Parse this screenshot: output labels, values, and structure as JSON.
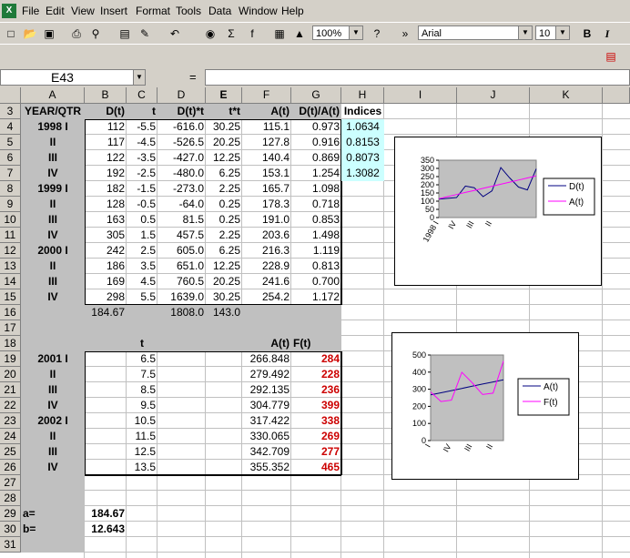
{
  "menu": [
    "File",
    "Edit",
    "View",
    "Insert",
    "Format",
    "Tools",
    "Data",
    "Window",
    "Help"
  ],
  "toolbar": {
    "zoom": "100%",
    "font": "Arial",
    "size": "10",
    "bold": "B",
    "italic": "I"
  },
  "namebox": "E43",
  "formula_eq": "=",
  "columns": [
    "A",
    "B",
    "C",
    "D",
    "E",
    "F",
    "G",
    "H",
    "I",
    "J",
    "K"
  ],
  "rows": [
    {
      "n": "3",
      "a": "YEAR/QTR",
      "b": "D(t)",
      "c": "t",
      "d": "D(t)*t",
      "e": "t*t",
      "f": "A(t)",
      "g": "D(t)/A(t)",
      "h": "Indices"
    },
    {
      "n": "4",
      "a": "1998 I",
      "b": "112",
      "c": "-5.5",
      "d": "-616.0",
      "e": "30.25",
      "f": "115.1",
      "g": "0.973",
      "h": "1.0634"
    },
    {
      "n": "5",
      "a": "II",
      "b": "117",
      "c": "-4.5",
      "d": "-526.5",
      "e": "20.25",
      "f": "127.8",
      "g": "0.916",
      "h": "0.8153"
    },
    {
      "n": "6",
      "a": "III",
      "b": "122",
      "c": "-3.5",
      "d": "-427.0",
      "e": "12.25",
      "f": "140.4",
      "g": "0.869",
      "h": "0.8073"
    },
    {
      "n": "7",
      "a": "IV",
      "b": "192",
      "c": "-2.5",
      "d": "-480.0",
      "e": "6.25",
      "f": "153.1",
      "g": "1.254",
      "h": "1.3082"
    },
    {
      "n": "8",
      "a": "1999 I",
      "b": "182",
      "c": "-1.5",
      "d": "-273.0",
      "e": "2.25",
      "f": "165.7",
      "g": "1.098",
      "h": ""
    },
    {
      "n": "9",
      "a": "II",
      "b": "128",
      "c": "-0.5",
      "d": "-64.0",
      "e": "0.25",
      "f": "178.3",
      "g": "0.718",
      "h": ""
    },
    {
      "n": "10",
      "a": "III",
      "b": "163",
      "c": "0.5",
      "d": "81.5",
      "e": "0.25",
      "f": "191.0",
      "g": "0.853",
      "h": ""
    },
    {
      "n": "11",
      "a": "IV",
      "b": "305",
      "c": "1.5",
      "d": "457.5",
      "e": "2.25",
      "f": "203.6",
      "g": "1.498",
      "h": ""
    },
    {
      "n": "12",
      "a": "2000 I",
      "b": "242",
      "c": "2.5",
      "d": "605.0",
      "e": "6.25",
      "f": "216.3",
      "g": "1.119",
      "h": ""
    },
    {
      "n": "13",
      "a": "II",
      "b": "186",
      "c": "3.5",
      "d": "651.0",
      "e": "12.25",
      "f": "228.9",
      "g": "0.813",
      "h": ""
    },
    {
      "n": "14",
      "a": "III",
      "b": "169",
      "c": "4.5",
      "d": "760.5",
      "e": "20.25",
      "f": "241.6",
      "g": "0.700",
      "h": ""
    },
    {
      "n": "15",
      "a": "IV",
      "b": "298",
      "c": "5.5",
      "d": "1639.0",
      "e": "30.25",
      "f": "254.2",
      "g": "1.172",
      "h": ""
    },
    {
      "n": "16",
      "a": "",
      "b": "184.67",
      "c": "",
      "d": "1808.0",
      "e": "143.0",
      "f": "",
      "g": "",
      "h": ""
    },
    {
      "n": "17",
      "a": "",
      "b": "",
      "c": "",
      "d": "",
      "e": "",
      "f": "",
      "g": "",
      "h": ""
    },
    {
      "n": "18",
      "a": "",
      "b": "",
      "c": "t",
      "d": "",
      "e": "",
      "f": "A(t)",
      "g": "F(t)",
      "h": ""
    },
    {
      "n": "19",
      "a": "2001 I",
      "b": "",
      "c": "6.5",
      "d": "",
      "e": "",
      "f": "266.848",
      "g": "284",
      "h": ""
    },
    {
      "n": "20",
      "a": "II",
      "b": "",
      "c": "7.5",
      "d": "",
      "e": "",
      "f": "279.492",
      "g": "228",
      "h": ""
    },
    {
      "n": "21",
      "a": "III",
      "b": "",
      "c": "8.5",
      "d": "",
      "e": "",
      "f": "292.135",
      "g": "236",
      "h": ""
    },
    {
      "n": "22",
      "a": "IV",
      "b": "",
      "c": "9.5",
      "d": "",
      "e": "",
      "f": "304.779",
      "g": "399",
      "h": ""
    },
    {
      "n": "23",
      "a": "2002 I",
      "b": "",
      "c": "10.5",
      "d": "",
      "e": "",
      "f": "317.422",
      "g": "338",
      "h": ""
    },
    {
      "n": "24",
      "a": "II",
      "b": "",
      "c": "11.5",
      "d": "",
      "e": "",
      "f": "330.065",
      "g": "269",
      "h": ""
    },
    {
      "n": "25",
      "a": "III",
      "b": "",
      "c": "12.5",
      "d": "",
      "e": "",
      "f": "342.709",
      "g": "277",
      "h": ""
    },
    {
      "n": "26",
      "a": "IV",
      "b": "",
      "c": "13.5",
      "d": "",
      "e": "",
      "f": "355.352",
      "g": "465",
      "h": ""
    },
    {
      "n": "27",
      "a": "",
      "b": "",
      "c": "",
      "d": "",
      "e": "",
      "f": "",
      "g": "",
      "h": ""
    },
    {
      "n": "28",
      "a": "",
      "b": "",
      "c": "",
      "d": "",
      "e": "",
      "f": "",
      "g": "",
      "h": ""
    },
    {
      "n": "29",
      "a": "a=",
      "b": "184.67",
      "c": "",
      "d": "",
      "e": "",
      "f": "",
      "g": "",
      "h": ""
    },
    {
      "n": "30",
      "a": "b=",
      "b": "12.643",
      "c": "",
      "d": "",
      "e": "",
      "f": "",
      "g": "",
      "h": ""
    },
    {
      "n": "31",
      "a": "",
      "b": "",
      "c": "",
      "d": "",
      "e": "",
      "f": "",
      "g": "",
      "h": ""
    }
  ],
  "chart_data": [
    {
      "type": "line",
      "categories": [
        "1998 I",
        "II",
        "III",
        "IV",
        "1999 I",
        "II",
        "III",
        "IV",
        "2000 I",
        "II",
        "III",
        "IV"
      ],
      "tick_labels": [
        "1998 I",
        "IV",
        "III",
        "II"
      ],
      "ylim": [
        0,
        350
      ],
      "yticks": [
        0,
        50,
        100,
        150,
        200,
        250,
        300,
        350
      ],
      "series": [
        {
          "name": "D(t)",
          "color": "#000080",
          "values": [
            112,
            117,
            122,
            192,
            182,
            128,
            163,
            305,
            242,
            186,
            169,
            298
          ]
        },
        {
          "name": "A(t)",
          "color": "#ff00ff",
          "values": [
            115.1,
            127.8,
            140.4,
            153.1,
            165.7,
            178.3,
            191.0,
            203.6,
            216.3,
            228.9,
            241.6,
            254.2
          ]
        }
      ],
      "legend": "right",
      "plot_background": "#c0c0c0"
    },
    {
      "type": "line",
      "categories": [
        "2001 I",
        "II",
        "III",
        "IV",
        "2002 I",
        "II",
        "III",
        "IV"
      ],
      "tick_labels": [
        "I",
        "IV",
        "III",
        "II"
      ],
      "ylim": [
        0,
        500
      ],
      "yticks": [
        0,
        100,
        200,
        300,
        400,
        500
      ],
      "series": [
        {
          "name": "A(t)",
          "color": "#000080",
          "values": [
            266.848,
            279.492,
            292.135,
            304.779,
            317.422,
            330.065,
            342.709,
            355.352
          ]
        },
        {
          "name": "F(t)",
          "color": "#ff00ff",
          "values": [
            284,
            228,
            236,
            399,
            338,
            269,
            277,
            465
          ]
        }
      ],
      "legend": "right",
      "plot_background": "#c0c0c0"
    }
  ]
}
